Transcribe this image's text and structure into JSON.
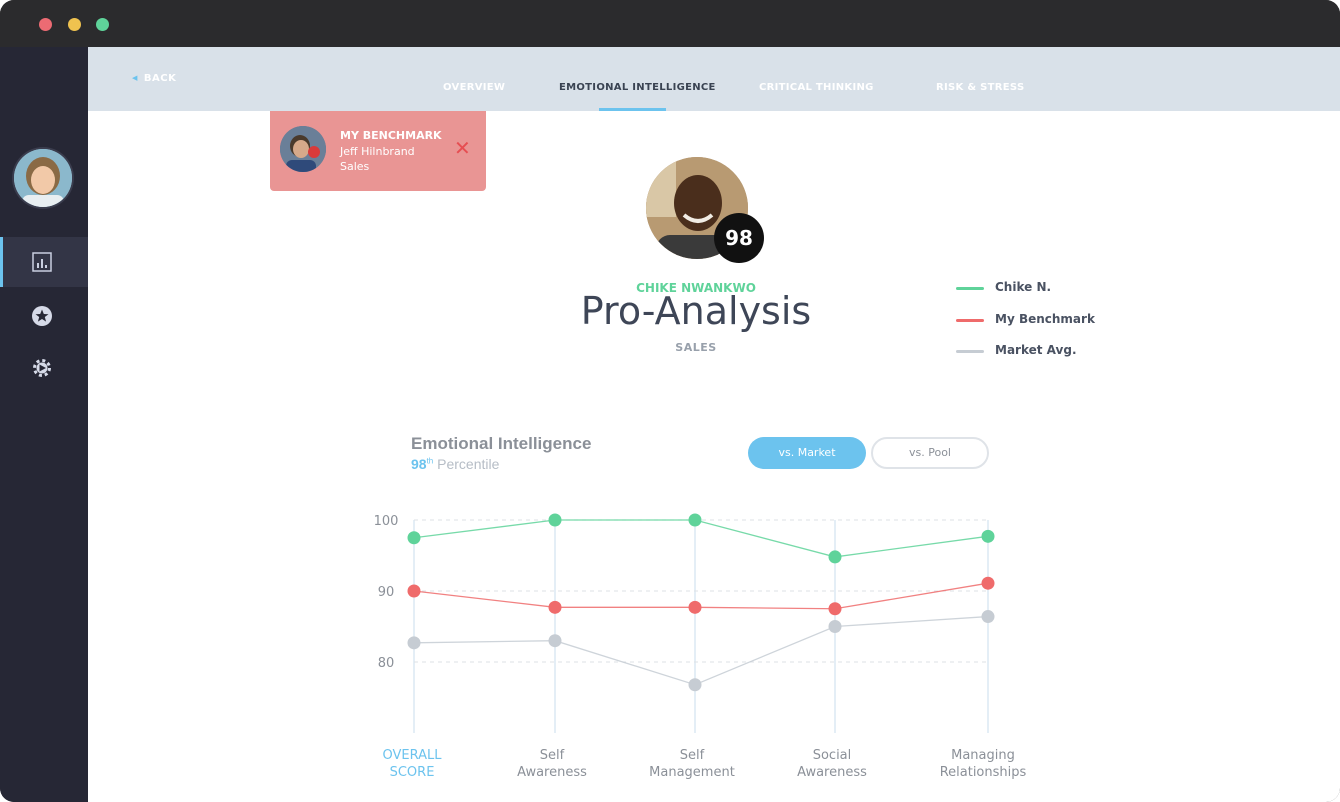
{
  "window": {
    "controls": [
      "close",
      "minimize",
      "maximize"
    ]
  },
  "sidebar": {
    "items": [
      {
        "icon": "bar-chart-icon",
        "active": true
      },
      {
        "icon": "star-icon",
        "active": false
      },
      {
        "icon": "gear-icon",
        "active": false
      }
    ]
  },
  "nav": {
    "back_label": "BACK",
    "tabs": [
      {
        "label": "OVERVIEW",
        "active": false
      },
      {
        "label": "EMOTIONAL INTELLIGENCE",
        "active": true
      },
      {
        "label": "CRITICAL THINKING",
        "active": false
      },
      {
        "label": "RISK & STRESS",
        "active": false
      }
    ]
  },
  "benchmark": {
    "title": "MY BENCHMARK",
    "name": "Jeff Hilnbrand",
    "role": "Sales",
    "close_icon": "close-icon"
  },
  "profile": {
    "score": "98",
    "name": "CHIKE NWANKWO",
    "title": "Pro-Analysis",
    "role": "SALES"
  },
  "legend": [
    {
      "label": "Chike N.",
      "color": "#5fd39a"
    },
    {
      "label": "My Benchmark",
      "color": "#ef6b6b"
    },
    {
      "label": "Market Avg.",
      "color": "#c6ccd3"
    }
  ],
  "chart_header": {
    "title": "Emotional Intelligence",
    "percentile_num": "98",
    "percentile_suffix": "th",
    "percentile_label": "Percentile"
  },
  "toggles": {
    "market": "vs. Market",
    "pool": "vs. Pool",
    "selected": "market"
  },
  "chart_data": {
    "type": "line",
    "categories": [
      [
        "OVERALL",
        "SCORE"
      ],
      [
        "Self",
        "Awareness"
      ],
      [
        "Self",
        "Management"
      ],
      [
        "Social",
        "Awareness"
      ],
      [
        "Managing",
        "Relationships"
      ]
    ],
    "highlight_category": 0,
    "yticks": [
      80,
      90,
      100
    ],
    "ylim": [
      70,
      100
    ],
    "series": [
      {
        "name": "Chike N.",
        "color": "#5fd39a",
        "values": [
          97.5,
          100,
          100,
          94.8,
          97.7
        ]
      },
      {
        "name": "My Benchmark",
        "color": "#ef6b6b",
        "values": [
          90,
          87.7,
          87.7,
          87.5,
          91.1
        ]
      },
      {
        "name": "Market Avg.",
        "color": "#c6ccd3",
        "values": [
          82.7,
          83,
          76.8,
          85,
          86.4
        ]
      }
    ],
    "grid": true
  }
}
